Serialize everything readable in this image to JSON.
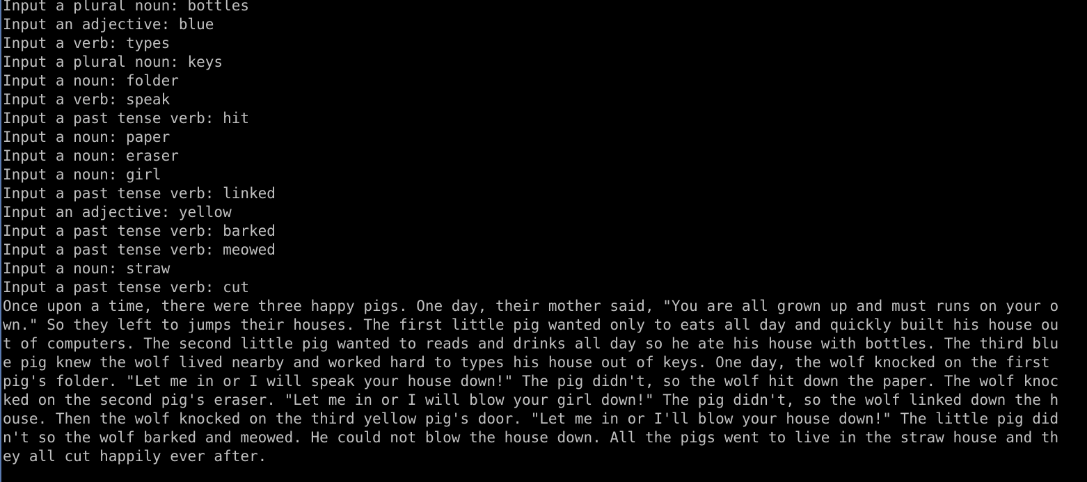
{
  "colors": {
    "background": "#000000",
    "text": "#c0c0c0"
  },
  "console": {
    "lines": [
      "Input a plural noun: bottles",
      "Input an adjective: blue",
      "Input a verb: types",
      "Input a plural noun: keys",
      "Input a noun: folder",
      "Input a verb: speak",
      "Input a past tense verb: hit",
      "Input a noun: paper",
      "Input a noun: eraser",
      "Input a noun: girl",
      "Input a past tense verb: linked",
      "Input an adjective: yellow",
      "Input a past tense verb: barked",
      "Input a past tense verb: meowed",
      "Input a noun: straw",
      "Input a past tense verb: cut",
      "Once upon a time, there were three happy pigs. One day, their mother said, \"You are all grown up and must runs on your o",
      "wn.\" So they left to jumps their houses. The first little pig wanted only to eats all day and quickly built his house ou",
      "t of computers. The second little pig wanted to reads and drinks all day so he ate his house with bottles. The third blu",
      "e pig knew the wolf lived nearby and worked hard to types his house out of keys. One day, the wolf knocked on the first",
      "pig's folder. \"Let me in or I will speak your house down!\" The pig didn't, so the wolf hit down the paper. The wolf knoc",
      "ked on the second pig's eraser. \"Let me in or I will blow your girl down!\" The pig didn't, so the wolf linked down the h",
      "ouse. Then the wolf knocked on the third yellow pig's door. \"Let me in or I'll blow your house down!\" The little pig did",
      "n't so the wolf barked and meowed. He could not blow the house down. All the pigs went to live in the straw house and th",
      "ey all cut happily ever after."
    ]
  }
}
